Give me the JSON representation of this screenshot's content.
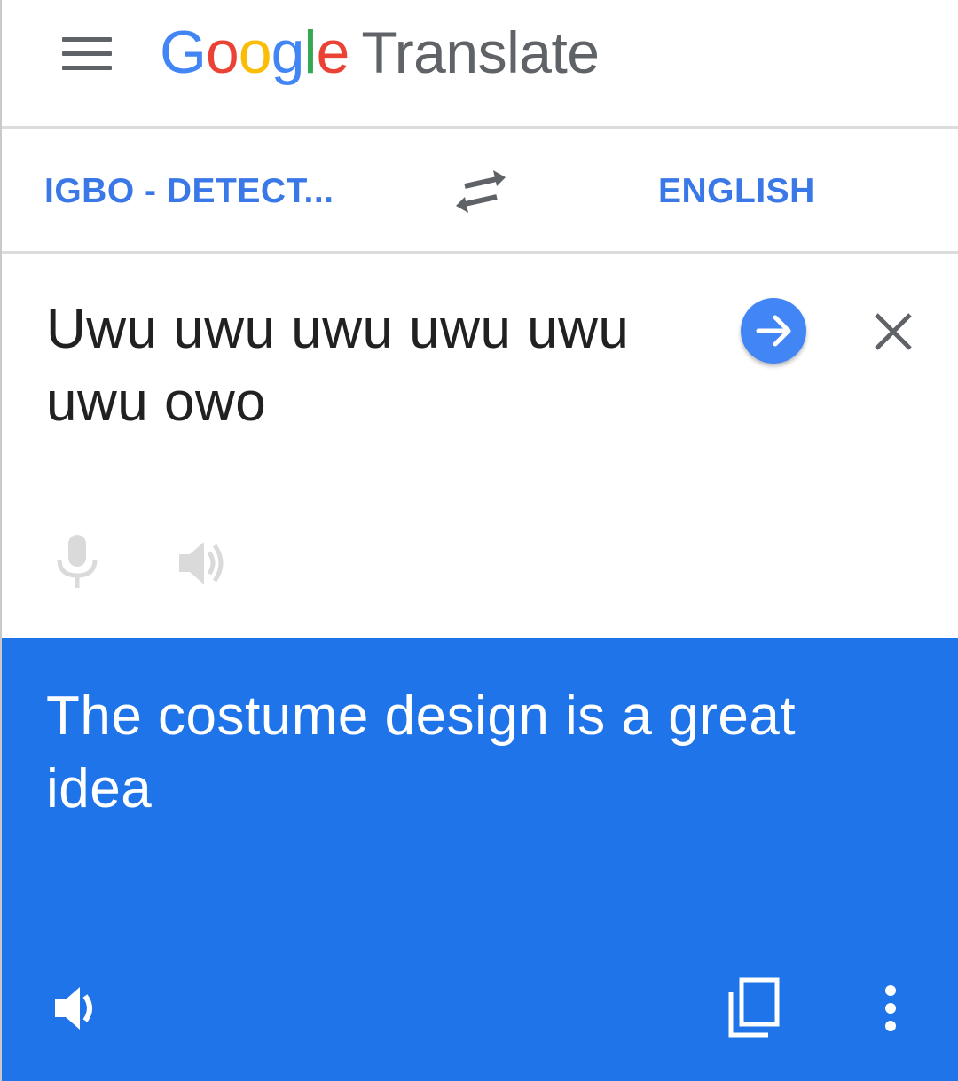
{
  "header": {
    "logo_letters": [
      {
        "ch": "G",
        "color": "#4285f4"
      },
      {
        "ch": "o",
        "color": "#ea4335"
      },
      {
        "ch": "o",
        "color": "#fbbc05"
      },
      {
        "ch": "g",
        "color": "#4285f4"
      },
      {
        "ch": "l",
        "color": "#34a853"
      },
      {
        "ch": "e",
        "color": "#ea4335"
      }
    ],
    "product_name": "Translate",
    "menu_icon": "hamburger-menu-icon"
  },
  "languages": {
    "source": "IGBO - DETECT...",
    "target": "ENGLISH",
    "swap_icon": "swap-arrows-icon"
  },
  "input": {
    "text": "Uwu uwu uwu uwu uwu uwu owo",
    "go_icon": "arrow-right-icon",
    "clear_icon": "close-icon",
    "mic_icon": "microphone-icon",
    "speaker_icon": "speaker-icon"
  },
  "output": {
    "text": "The costume design is a great idea",
    "speaker_icon": "speaker-icon",
    "copy_icon": "copy-icon",
    "more_icon": "more-vert-icon"
  },
  "colors": {
    "accent_blue": "#3b78e7",
    "output_background": "#1e74e8",
    "go_button": "#4285f4",
    "icon_gray": "#5f6368",
    "disabled_gray": "#dadada"
  }
}
